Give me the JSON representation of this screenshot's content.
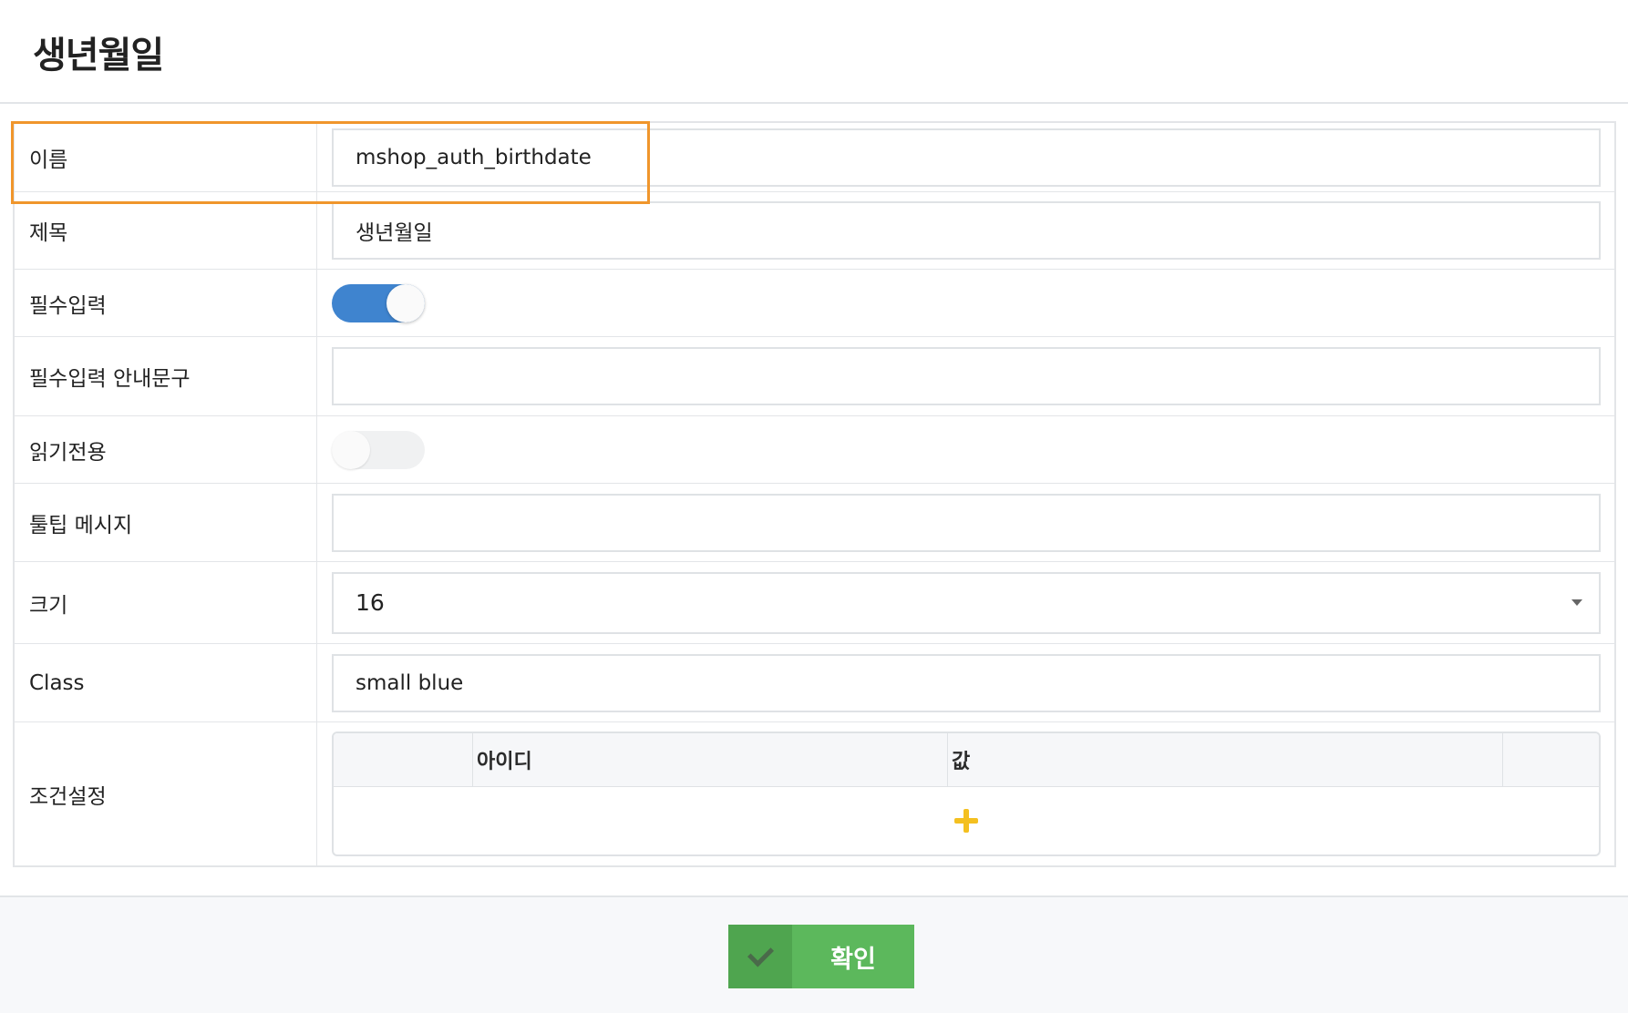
{
  "header": {
    "title": "생년월일"
  },
  "form": {
    "name": {
      "label": "이름",
      "value": "mshop_auth_birthdate"
    },
    "subject": {
      "label": "제목",
      "value": "생년월일"
    },
    "required": {
      "label": "필수입력",
      "state": "on"
    },
    "required_msg": {
      "label": "필수입력 안내문구",
      "value": ""
    },
    "readonly": {
      "label": "읽기전용",
      "state": "off"
    },
    "tooltip": {
      "label": "툴팁 메시지",
      "value": ""
    },
    "size": {
      "label": "크기",
      "value": "16"
    },
    "class": {
      "label": "Class",
      "value": "small blue"
    },
    "conditions": {
      "label": "조건설정",
      "columns": [
        "아이디",
        "값"
      ]
    }
  },
  "footer": {
    "confirm_label": "확인"
  },
  "colors": {
    "highlight": "#f0962c",
    "toggle_on": "#3f84cf",
    "confirm": "#5cb85c",
    "add_icon": "#f4c020"
  }
}
